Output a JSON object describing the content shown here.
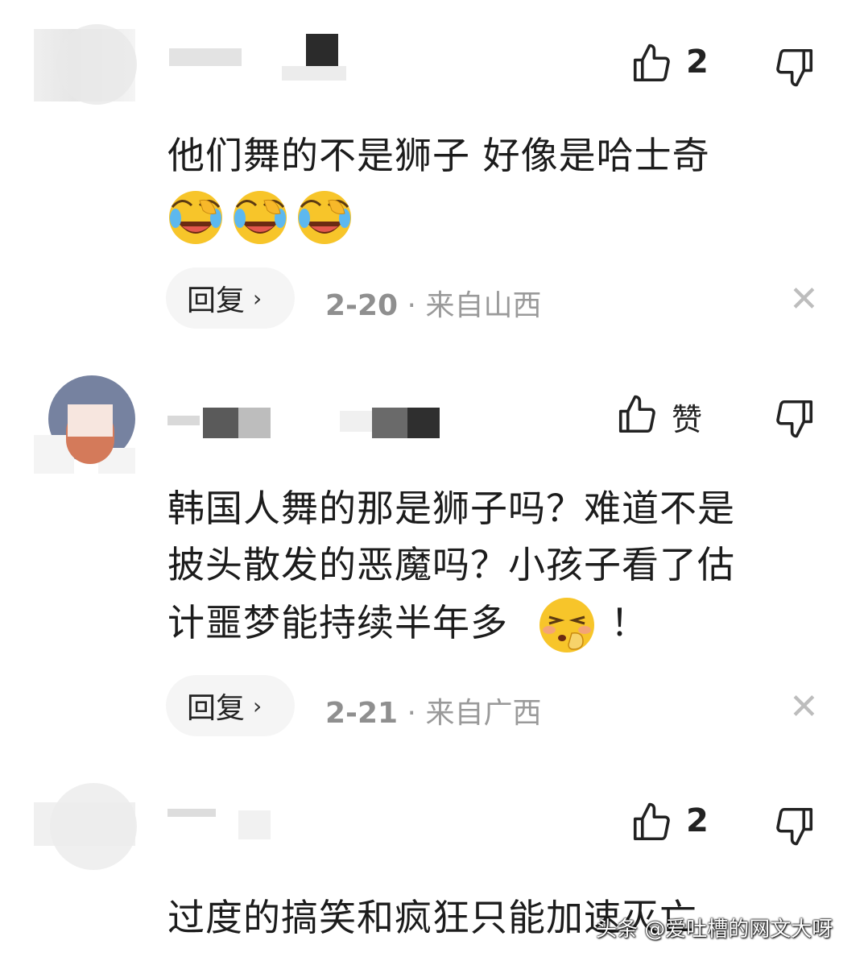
{
  "comments": [
    {
      "likes": "2",
      "text_lines": [
        "他们舞的不是狮子 好像是哈士奇"
      ],
      "emojis": [
        "laugh-cry-emoji",
        "laugh-cry-emoji",
        "laugh-cry-emoji"
      ],
      "reply_label": "回复",
      "date": "2-20",
      "separator": "·",
      "location": "来自山西"
    },
    {
      "likes": "赞",
      "text_lines": [
        "韩国人舞的那是狮子吗？难道不是",
        "披头散发的恶魔吗？小孩子看了估",
        "计噩梦能持续半年多"
      ],
      "trailing_text": "！",
      "emoji": "shush-face-emoji",
      "reply_label": "回复",
      "date": "2-21",
      "separator": "·",
      "location": "来自广西"
    },
    {
      "likes": "2",
      "text_lines": [
        "过度的搞笑和疯狂只能加速灭亡"
      ]
    }
  ],
  "watermark": "头条 @爱吐槽的网文大呀",
  "colors": {
    "background": "#ffffff",
    "text": "#1c1c1c",
    "meta": "#9a9a9a",
    "pill": "#f5f5f5",
    "emoji_yellow": "#f7c52a"
  }
}
